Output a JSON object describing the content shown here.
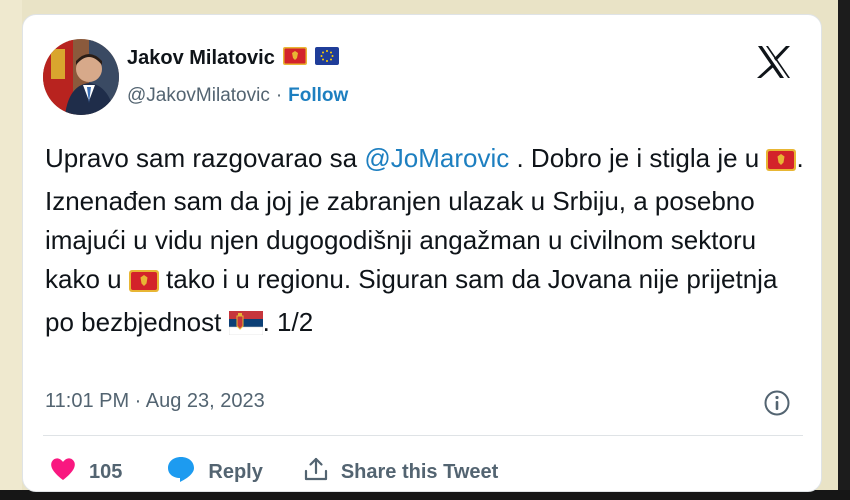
{
  "author": {
    "name": "Jakov Milatovic",
    "handle": "@JakovMilatovic",
    "separator": "·",
    "follow_label": "Follow"
  },
  "tweet": {
    "part1": "Upravo sam razgovarao sa ",
    "mention": "@JoMarovic",
    "part2": " . Dobro je i stigla je u ",
    "part3": ". Iznenađen sam da joj je zabranjen ulazak u Srbiju, a posebno imajući u vidu njen dugogodišnji angažman u civilnom sektoru kako u ",
    "part4": " tako i u regionu. Siguran sam da Jovana nije prijetnja po bezbjednost ",
    "part5": ". 1/2"
  },
  "timestamp": "11:01 PM · Aug 23, 2023",
  "actions": {
    "like_count": "105",
    "reply_label": "Reply",
    "share_label": "Share this Tweet"
  },
  "colors": {
    "link": "#1d7fc0",
    "like": "#f91880",
    "reply": "#1d9bf0",
    "montenegro_red": "#d3232a",
    "montenegro_gold": "#e8b634"
  },
  "icons": [
    "x-logo-icon",
    "montenegro-flag-icon",
    "eu-flag-icon",
    "serbia-flag-icon",
    "info-icon",
    "heart-icon",
    "reply-bubble-icon",
    "share-icon"
  ]
}
